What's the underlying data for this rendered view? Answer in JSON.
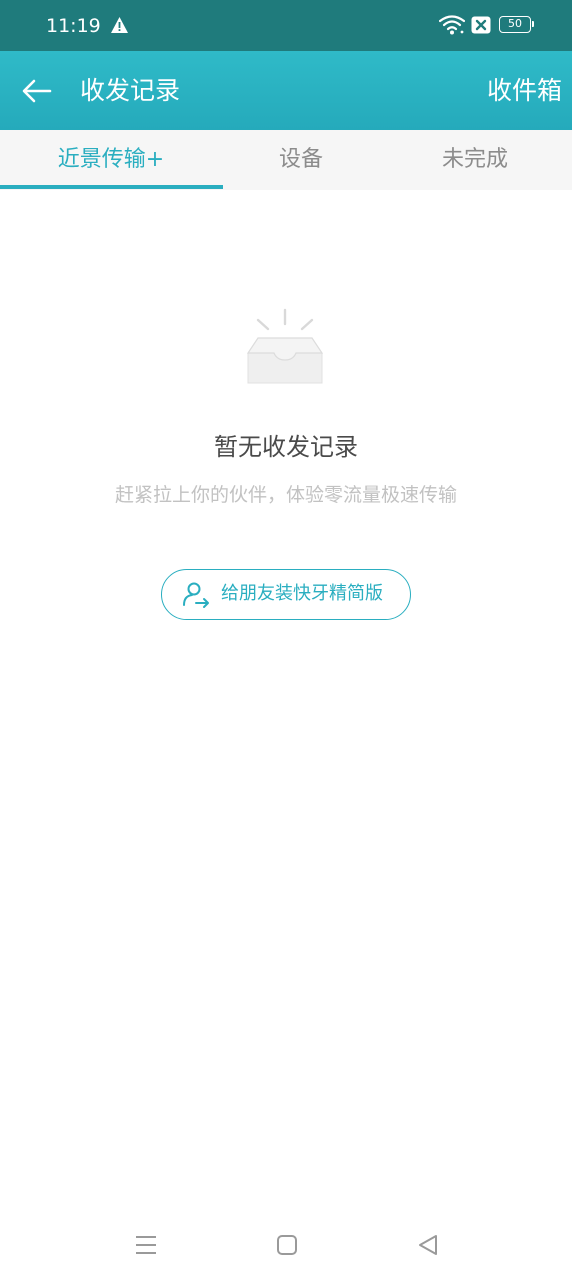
{
  "status_bar": {
    "time": "11:19",
    "battery": "50",
    "icons": [
      "warning-icon",
      "wifi-icon",
      "x-box-icon",
      "battery-icon"
    ]
  },
  "header": {
    "title": "收发记录",
    "inbox_label": "收件箱",
    "back_icon": "back-arrow-icon"
  },
  "tabs": [
    {
      "label": "近景传输+",
      "active": true
    },
    {
      "label": "设备",
      "active": false
    },
    {
      "label": "未完成",
      "active": false
    }
  ],
  "empty_state": {
    "icon": "empty-inbox-icon",
    "title": "暂无收发记录",
    "subtitle": "赶紧拉上你的伙伴，体验零流量极速传输",
    "button_label": "给朋友装快牙精简版",
    "button_icon": "share-user-icon"
  },
  "colors": {
    "status_bar": "#1f7b7c",
    "header": "#2bb4c5",
    "accent": "#2aaec0",
    "tab_bg": "#f6f6f6"
  },
  "nav": [
    "menu-icon",
    "home-icon",
    "back-triangle-icon"
  ]
}
